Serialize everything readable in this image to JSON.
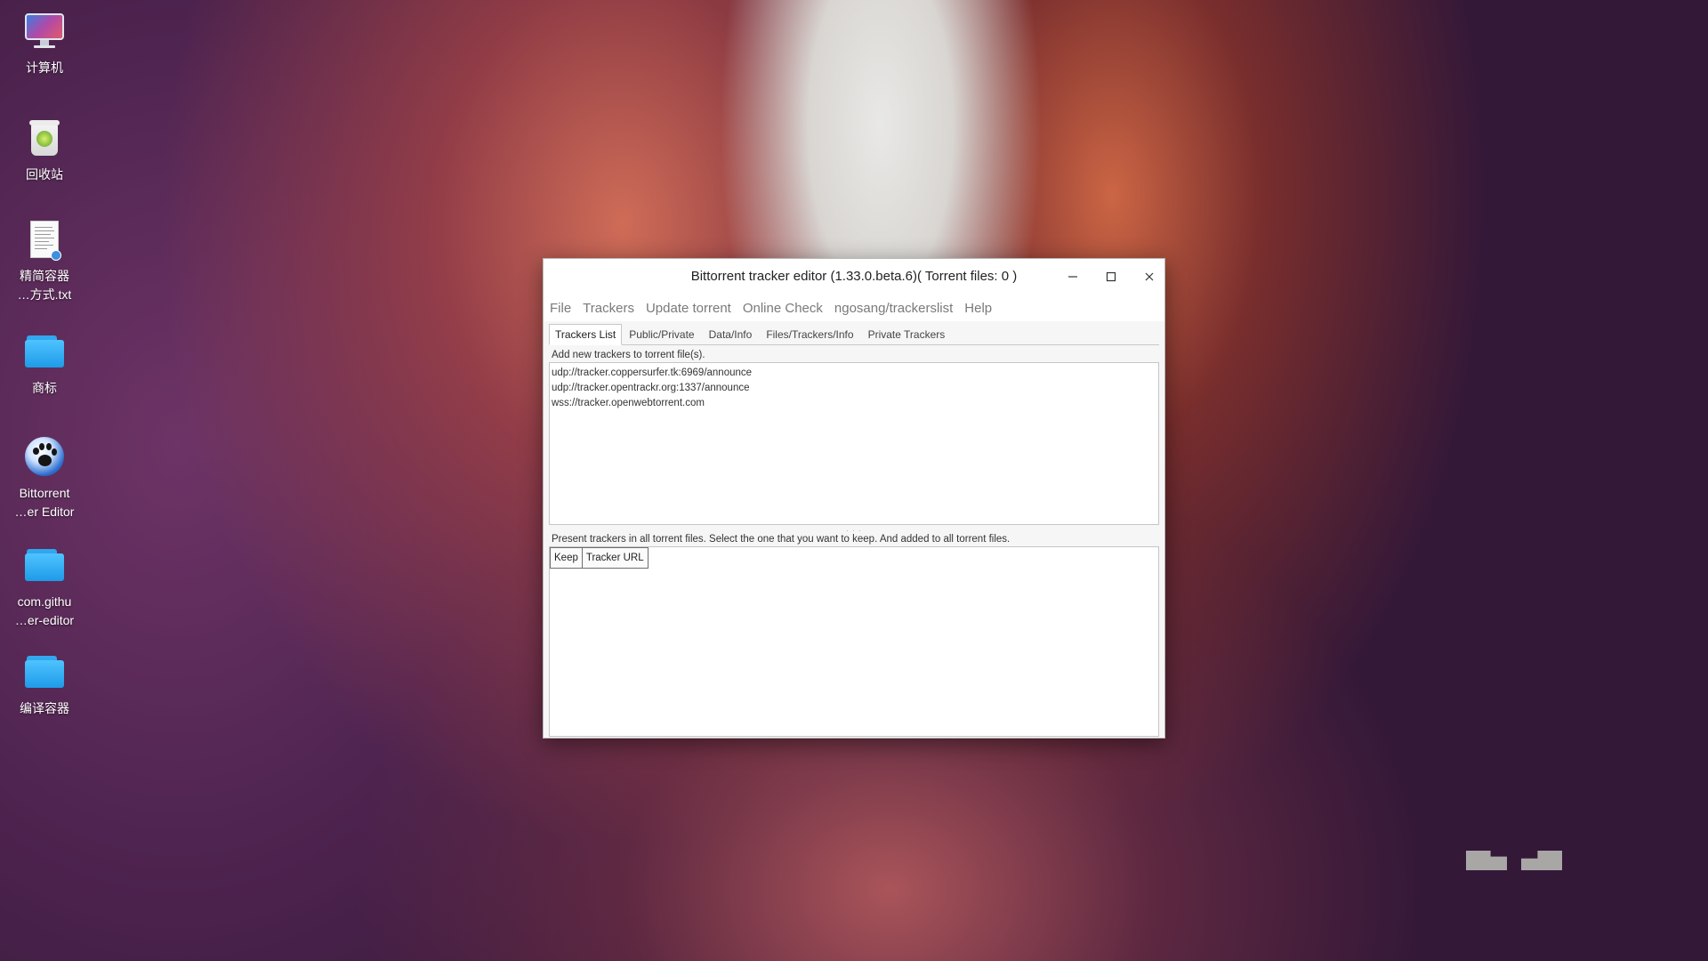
{
  "desktop": {
    "icons": [
      {
        "label_line1": "计算机",
        "label_line2": ""
      },
      {
        "label_line1": "回收站",
        "label_line2": ""
      },
      {
        "label_line1": "精简容器",
        "label_line2": "…方式.txt"
      },
      {
        "label_line1": "商标",
        "label_line2": ""
      },
      {
        "label_line1": "Bittorrent",
        "label_line2": "…er Editor"
      },
      {
        "label_line1": "com.githu",
        "label_line2": "…er-editor"
      },
      {
        "label_line1": "编译容器",
        "label_line2": ""
      }
    ]
  },
  "window": {
    "title": "Bittorrent tracker editor (1.33.0.beta.6)( Torrent files: 0 )",
    "menu": [
      "File",
      "Trackers",
      "Update torrent",
      "Online Check",
      "ngosang/trackerslist",
      "Help"
    ],
    "tabs": [
      "Trackers List",
      "Public/Private",
      "Data/Info",
      "Files/Trackers/Info",
      "Private Trackers"
    ],
    "add_group_label": "Add new trackers to torrent file(s).",
    "new_trackers": [
      "udp://tracker.coppersurfer.tk:6969/announce",
      "udp://tracker.opentrackr.org:1337/announce",
      "wss://tracker.openwebtorrent.com"
    ],
    "present_group_label": "Present trackers in all torrent files. Select the one that you want to keep. And added to all torrent files.",
    "columns": [
      "Keep",
      "Tracker URL"
    ]
  },
  "colors": {
    "window_bg": "#f6f6f6",
    "menu_text": "#7a7a7a"
  }
}
